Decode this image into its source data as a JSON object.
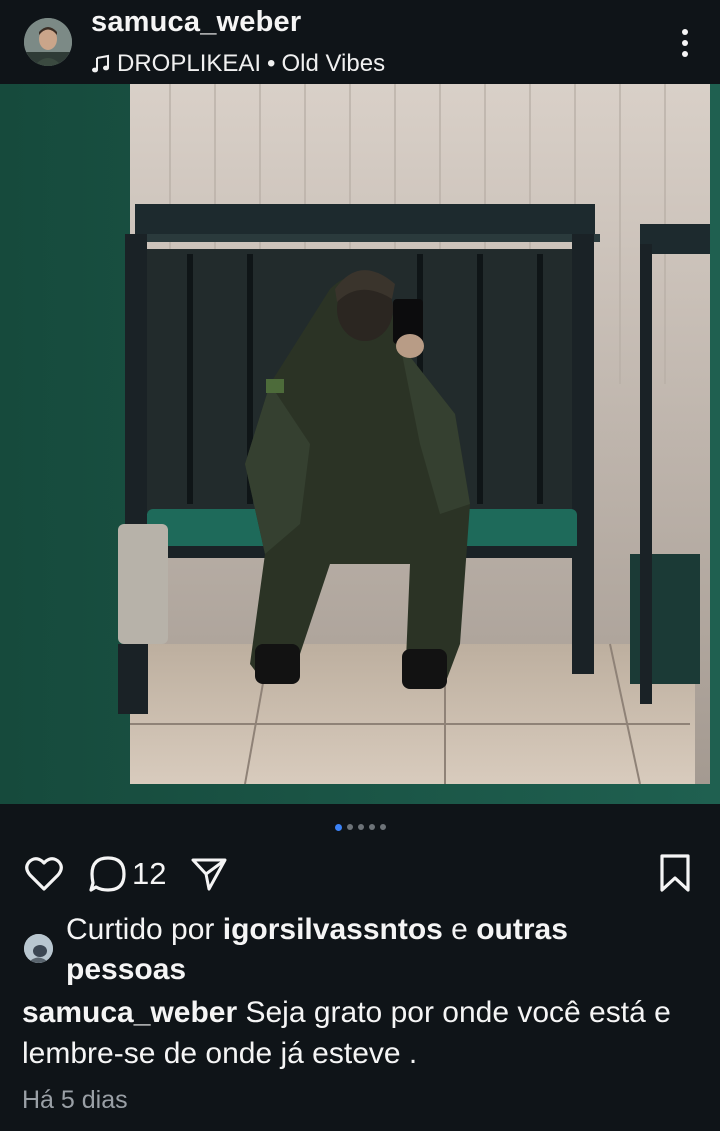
{
  "post": {
    "username": "samuca_weber",
    "music": {
      "artist": "DROPLIKEAI",
      "separator": "•",
      "track": "Old Vibes"
    },
    "comment_count": "12",
    "likes": {
      "prefix": "Curtido por",
      "user": "igorsilvassntos",
      "conjunction": "e",
      "others": "outras pessoas"
    },
    "caption": {
      "username": "samuca_weber",
      "text": "Seja grato por onde você está e lembre-se de onde já esteve ."
    },
    "timestamp": "Há 5 dias",
    "carousel": {
      "total": 5,
      "active_index": 0
    }
  },
  "icons": {
    "music": "music-note-icon",
    "more": "more-vertical-icon",
    "like": "heart-icon",
    "comment": "comment-bubble-icon",
    "share": "share-paper-plane-icon",
    "save": "bookmark-icon"
  },
  "colors": {
    "background": "#0f1418",
    "text": "#f5f5f5",
    "muted_text": "#9aa0a6",
    "active_dot": "#3b82f6",
    "inactive_dot": "#6d7378",
    "wall_green": "#1d5c4a"
  }
}
